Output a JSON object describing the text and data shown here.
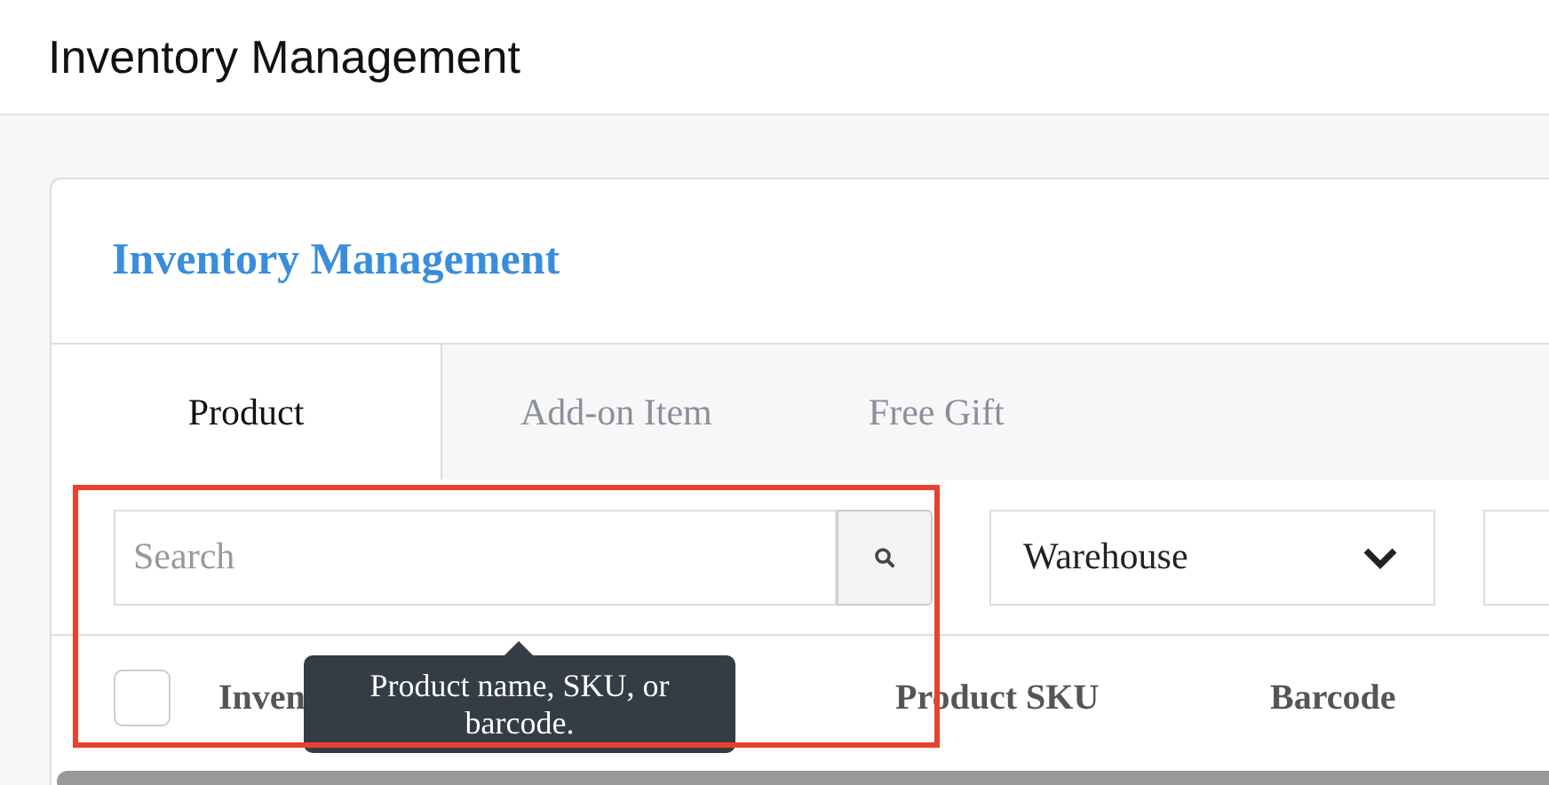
{
  "page_title": "Inventory Management",
  "card_title": "Inventory Management",
  "tabs": [
    {
      "label": "Product",
      "selected": true
    },
    {
      "label": "Add-on Item",
      "selected": false
    },
    {
      "label": "Free Gift",
      "selected": false
    }
  ],
  "search": {
    "placeholder": "Search"
  },
  "warehouse_select": {
    "value": "Warehouse"
  },
  "table": {
    "select_all_checked": false,
    "columns": [
      "Inven",
      "Product SKU",
      "Barcode"
    ]
  },
  "tooltip": "Product name, SKU, or barcode."
}
